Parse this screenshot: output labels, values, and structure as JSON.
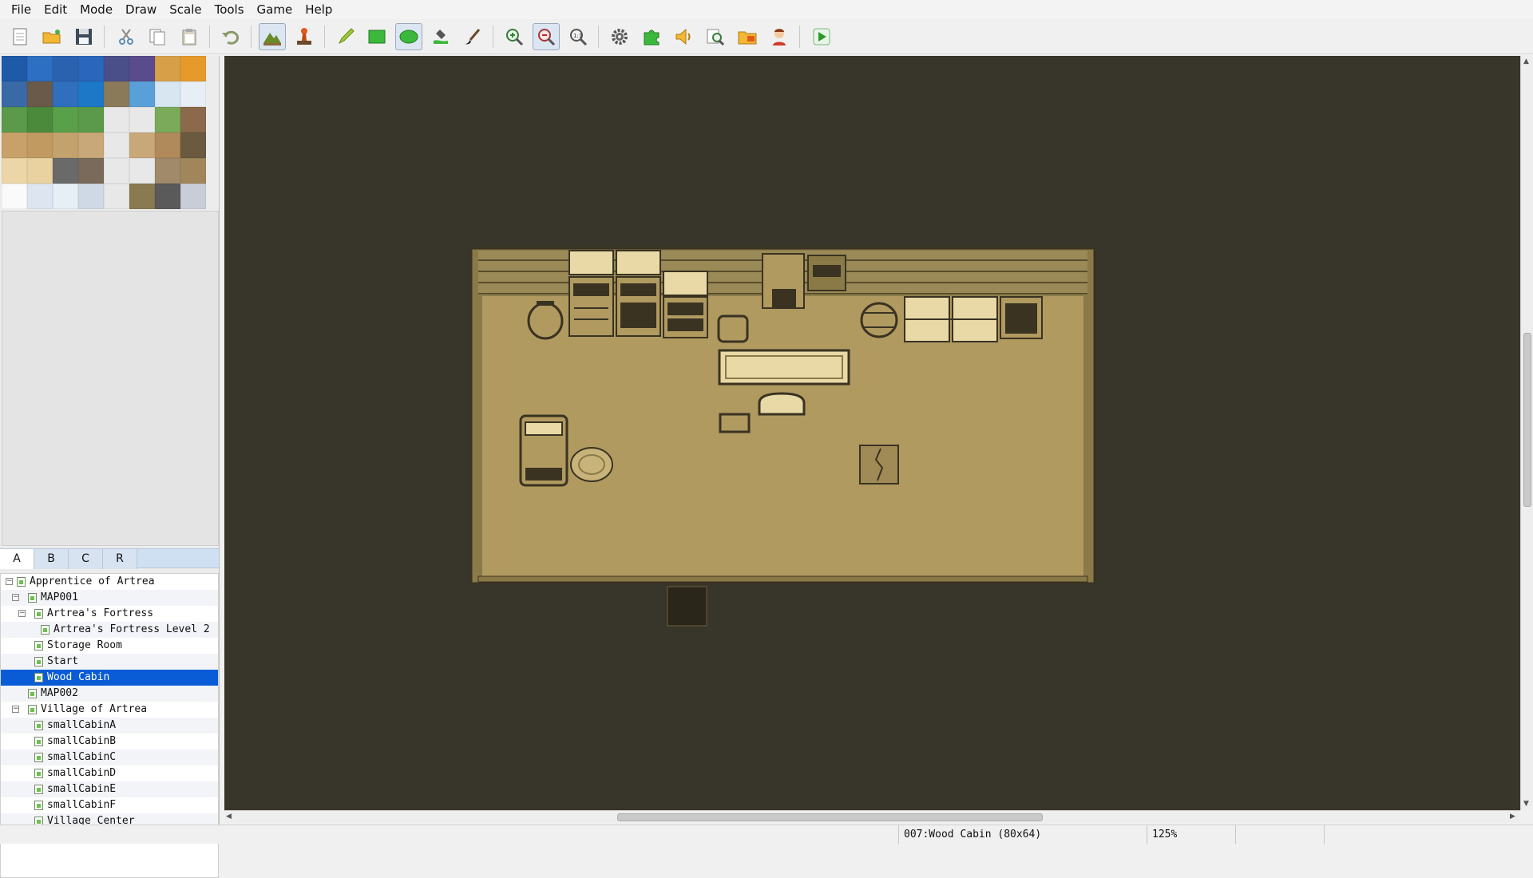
{
  "menubar": {
    "items": [
      "File",
      "Edit",
      "Mode",
      "Draw",
      "Scale",
      "Tools",
      "Game",
      "Help"
    ]
  },
  "toolbar": {
    "buttons": [
      "new-project",
      "open-project",
      "save",
      "cut",
      "copy",
      "paste",
      "undo",
      "map-layer",
      "event-layer",
      "pencil",
      "rectangle",
      "ellipse",
      "fill",
      "shadow-pen",
      "zoom-in",
      "zoom-out",
      "zoom-actual",
      "database",
      "resource-manager",
      "sound-test",
      "event-searcher",
      "open-folder",
      "character-generator",
      "playtest"
    ],
    "active": [
      "map-layer",
      "ellipse",
      "zoom-out"
    ]
  },
  "tileset": {
    "colors": [
      [
        "#1e5aa8",
        "#2d6fc0",
        "#2a62b0",
        "#2a66bb",
        "#4a4f8a",
        "#5a4c8c",
        "#d7a048",
        "#e69a2a"
      ],
      [
        "#3a6aa6",
        "#6a5a4a",
        "#2f6fbd",
        "#1e78c8",
        "#8a7a5a",
        "#5aa0d8",
        "#d8e6f2",
        "#e8eef5"
      ],
      [
        "#5a9a4a",
        "#4a8a3a",
        "#5aa04a",
        "#5a9a4a",
        "#e8e8e8",
        "#e8e8e8",
        "#7aaa5a",
        "#8a6a4a"
      ],
      [
        "#c8a06a",
        "#c09a60",
        "#c4a26e",
        "#c8a878",
        "#e8e8e8",
        "#c8a878",
        "#b08a5a",
        "#6a5a40"
      ],
      [
        "#ecd6a8",
        "#ead2a0",
        "#6a6a6a",
        "#7a6a5a",
        "#e8e8e8",
        "#e8e8e8",
        "#a08a6a",
        "#a0865a"
      ],
      [
        "#fafafa",
        "#dde6f0",
        "#e6eef6",
        "#cfd9e6",
        "#e8e8e8",
        "#8a7a50",
        "#5a5a5a",
        "#c8cdd8"
      ]
    ]
  },
  "tabs": [
    "A",
    "B",
    "C",
    "R"
  ],
  "tree": [
    {
      "label": "Apprentice of Artrea",
      "level": 0,
      "expander": "−",
      "root": true
    },
    {
      "label": "MAP001",
      "level": 1,
      "expander": "−"
    },
    {
      "label": "Artrea's Fortress",
      "level": 2,
      "expander": "−"
    },
    {
      "label": "Artrea's Fortress Level 2",
      "level": 3
    },
    {
      "label": "Storage Room",
      "level": 2
    },
    {
      "label": "Start",
      "level": 2
    },
    {
      "label": "Wood Cabin",
      "level": 2,
      "selected": true
    },
    {
      "label": "MAP002",
      "level": 1
    },
    {
      "label": "Village of Artrea",
      "level": 1,
      "expander": "−"
    },
    {
      "label": "smallCabinA",
      "level": 2
    },
    {
      "label": "smallCabinB",
      "level": 2
    },
    {
      "label": "smallCabinC",
      "level": 2
    },
    {
      "label": "smallCabinD",
      "level": 2
    },
    {
      "label": "smallCabinE",
      "level": 2
    },
    {
      "label": "smallCabinF",
      "level": 2
    },
    {
      "label": "Village Center",
      "level": 2
    }
  ],
  "status": {
    "map_info": "007:Wood Cabin (80x64)",
    "zoom": "125%"
  },
  "colors": {
    "map_background": "#38352a",
    "floor": "#b09a60",
    "wall": "#8a7a48",
    "dark": "#3a3322",
    "light": "#e8d9a6",
    "selection": "#0a5cd6"
  }
}
